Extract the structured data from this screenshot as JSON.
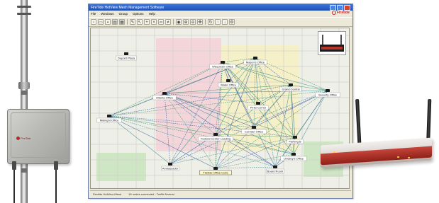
{
  "outdoor_unit": {
    "brand": "FireTide"
  },
  "window": {
    "title": "FireTide HotView Mesh Management Software",
    "menus": [
      "File",
      "Windows",
      "Group",
      "Options",
      "Help"
    ],
    "logo_text": "Firetide",
    "toolbar_icons": [
      "new-icon",
      "open-icon",
      "save-icon",
      "print-icon",
      "image-icon",
      "tool-icon",
      "select-icon",
      "add-node-icon",
      "delete-icon",
      "link-icon",
      "unlink-icon",
      "view-icon",
      "zoom-in-icon",
      "zoom-out-icon",
      "pan-icon",
      "refresh-icon",
      "up-icon",
      "down-icon",
      "settings-icon"
    ]
  },
  "map": {
    "nodes": [
      {
        "id": "n1",
        "label": "Dupont Plaza"
      },
      {
        "id": "n2",
        "label": "Wisconsin Office"
      },
      {
        "id": "n3",
        "label": "Mason's Office"
      },
      {
        "id": "n4",
        "label": "Water Office"
      },
      {
        "id": "n5",
        "label": "Atlanta Office"
      },
      {
        "id": "n6",
        "label": "Grand Central"
      },
      {
        "id": "n7",
        "label": "Pinto Corner"
      },
      {
        "id": "n8",
        "label": "Security Office"
      },
      {
        "id": "n9",
        "label": "Midnight Office"
      },
      {
        "id": "n10",
        "label": "Corridor Office"
      },
      {
        "id": "n11",
        "label": "Federal Center Loading"
      },
      {
        "id": "n12",
        "label": "Parking B"
      },
      {
        "id": "n13",
        "label": "Ambassador"
      },
      {
        "id": "n14",
        "label": "Lindsey's Office"
      },
      {
        "id": "n15",
        "label": "Firetide Office Cube"
      },
      {
        "id": "n16",
        "label": "Board Room"
      }
    ],
    "selected_node": "n15"
  },
  "status": {
    "left": "Firetide HotView Mesh",
    "right": "16 nodes connected · Traffic Normal"
  },
  "colors": {
    "link_green": "#4a9a6a",
    "link_blue": "#3d5fa8",
    "link_teal": "#3e8e9c",
    "router_red": "#b8352c",
    "map_park": "#cfe6c4",
    "map_pink": "#f4d6da",
    "map_yellow": "#f6f0c8"
  }
}
